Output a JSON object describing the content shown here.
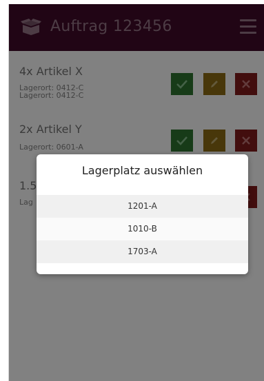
{
  "header": {
    "title": "Auftrag 123456",
    "icon": "box-icon",
    "menu_icon": "menu-icon"
  },
  "items": [
    {
      "name": "4x Artikel X",
      "locations": [
        "Lagerort: 0412-C",
        "Lagerort: 0412-C"
      ]
    },
    {
      "name": "2x Artikel Y",
      "locations": [
        "Lagerort: 0601-A"
      ]
    },
    {
      "name": "1.5m",
      "locations": [
        "Lag"
      ]
    }
  ],
  "dialog": {
    "title": "Lagerplatz auswählen",
    "options": [
      "1201-A",
      "1010-B",
      "1703-A"
    ]
  },
  "colors": {
    "header_bg": "#3d0a28",
    "ok": "#2b6e2e",
    "edit": "#856713",
    "delete": "#7a1b1b"
  }
}
